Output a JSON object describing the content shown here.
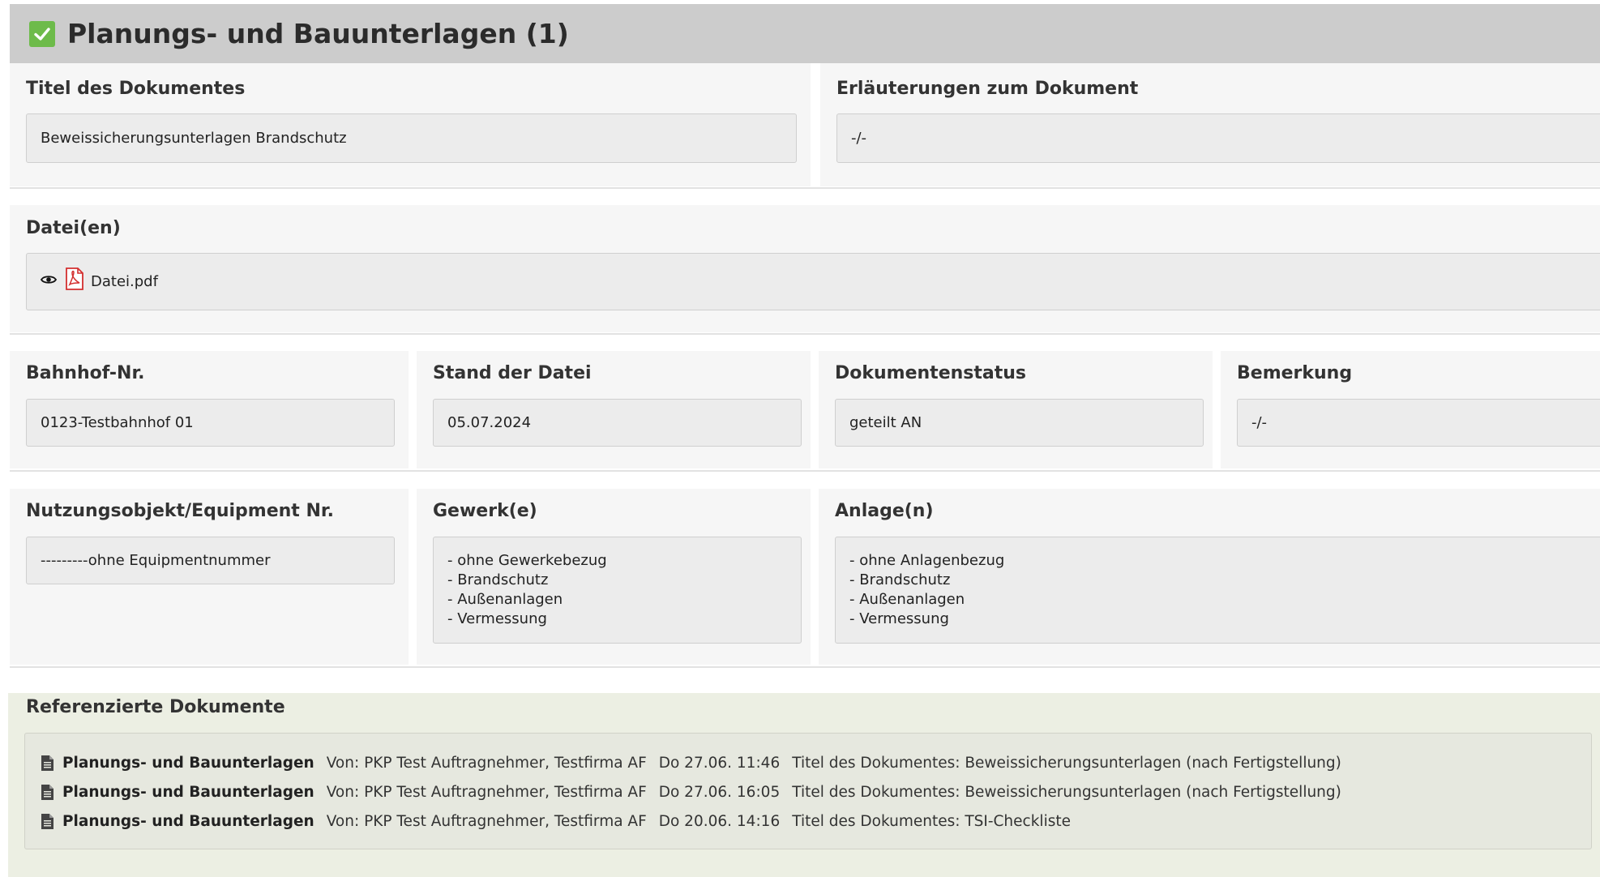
{
  "section": {
    "title": "Planungs- und Bauunterlagen (1)"
  },
  "titel": {
    "label": "Titel des Dokumentes",
    "value": "Beweissicherungsunterlagen Brandschutz"
  },
  "erlaeuterungen": {
    "label": "Erläuterungen zum Dokument",
    "value": "-/-"
  },
  "dateien": {
    "label": "Datei(en)",
    "file_name": "Datei.pdf"
  },
  "bahnhof": {
    "label": "Bahnhof-Nr.",
    "value": "0123-Testbahnhof 01"
  },
  "stand": {
    "label": "Stand der Datei",
    "value": "05.07.2024"
  },
  "status": {
    "label": "Dokumentenstatus",
    "value": "geteilt AN"
  },
  "bemerkung": {
    "label": "Bemerkung",
    "value": "-/-"
  },
  "nutzungsobjekt": {
    "label": "Nutzungsobjekt/Equipment Nr.",
    "value": "---------ohne Equipmentnummer"
  },
  "gewerke": {
    "label": "Gewerk(e)",
    "items": [
      "- ohne Gewerkebezug",
      "- Brandschutz",
      "- Außenanlagen",
      "- Vermessung"
    ]
  },
  "anlagen": {
    "label": "Anlage(n)",
    "items": [
      "- ohne Anlagenbezug",
      "- Brandschutz",
      "- Außenanlagen",
      "- Vermessung"
    ]
  },
  "referenced": {
    "label": "Referenzierte Dokumente",
    "rows": [
      {
        "category": "Planungs- und Bauunterlagen",
        "from": "Von: PKP Test Auftragnehmer, Testfirma AF",
        "date": "Do 27.06. 11:46",
        "title": "Titel des Dokumentes: Beweissicherungsunterlagen (nach Fertigstellung)"
      },
      {
        "category": "Planungs- und Bauunterlagen",
        "from": "Von: PKP Test Auftragnehmer, Testfirma AF",
        "date": "Do 27.06. 16:05",
        "title": "Titel des Dokumentes: Beweissicherungsunterlagen (nach Fertigstellung)"
      },
      {
        "category": "Planungs- und Bauunterlagen",
        "from": "Von: PKP Test Auftragnehmer, Testfirma AF",
        "date": "Do 20.06. 14:16",
        "title": "Titel des Dokumentes: TSI-Checkliste"
      }
    ]
  },
  "icons": {
    "section_check": "checkbox-checked-icon",
    "file_view": "eye-icon",
    "file_type": "pdf-file-icon",
    "reference_doc": "document-icon"
  },
  "colors": {
    "header_bg": "#cccccc",
    "check_green": "#6dbb4a",
    "field_bg": "#ececec",
    "reference_bg": "#ecefe3",
    "pdf_red": "#d32f2f"
  }
}
